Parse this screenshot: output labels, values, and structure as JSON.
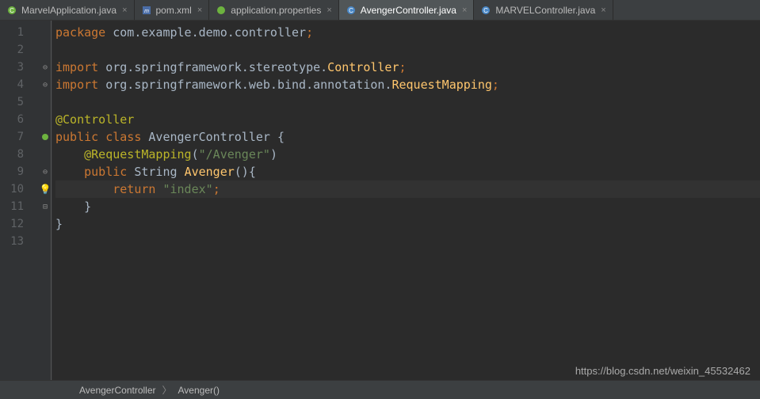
{
  "tabs": [
    {
      "label": "MarvelApplication.java",
      "icon": "java",
      "active": false
    },
    {
      "label": "pom.xml",
      "icon": "maven",
      "active": false
    },
    {
      "label": "application.properties",
      "icon": "spring",
      "active": false
    },
    {
      "label": "AvengerController.java",
      "icon": "class",
      "active": true
    },
    {
      "label": "MARVELController.java",
      "icon": "class",
      "active": false
    }
  ],
  "gutter": [
    "1",
    "2",
    "3",
    "4",
    "5",
    "6",
    "7",
    "8",
    "9",
    "10",
    "11",
    "12",
    "13"
  ],
  "code": {
    "l1_kw": "package",
    "l1_pkg": " com.example.demo.controller",
    "l3_kw": "import",
    "l3_pkg": " org.springframework.stereotype.",
    "l3_cls": "Controller",
    "l4_kw": "import",
    "l4_pkg": " org.springframework.web.bind.annotation.",
    "l4_cls": "RequestMapping",
    "l6_ann": "@Controller",
    "l7_kw1": "public",
    "l7_kw2": "class",
    "l7_cls": "AvengerController",
    "l7_brace": " {",
    "l8_ann": "@RequestMapping",
    "l8_paren_open": "(",
    "l8_str": "\"/Avenger\"",
    "l8_paren_close": ")",
    "l9_kw1": "public",
    "l9_type": "String",
    "l9_name": "Avenger",
    "l9_paren": "(){",
    "l10_kw": "return",
    "l10_str": " \"index\"",
    "l11_brace": "}",
    "l12_brace": "}",
    "semi": ";"
  },
  "breadcrumb": {
    "item1": "AvengerController",
    "item2": "Avenger()"
  },
  "watermark": "https://blog.csdn.net/weixin_45532462"
}
